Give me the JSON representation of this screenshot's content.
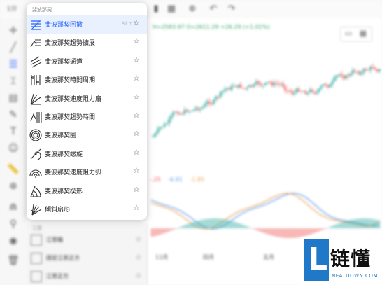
{
  "toolbar": {
    "left_label": "1分",
    "icons": [
      "candles-icon",
      "indicator-icon",
      "grid-icon",
      "add-icon",
      "undo-icon",
      "redo-icon"
    ]
  },
  "left_tools": [
    "crosshair-icon",
    "trendline-icon",
    "fibonacci-icon",
    "pattern-icon",
    "prediction-icon",
    "brush-icon",
    "text-icon",
    "emoji-icon",
    "ruler-icon",
    "zoom-icon",
    "magnet-icon",
    "lock-icon",
    "visibility-icon",
    "trash-icon"
  ],
  "chart": {
    "info_line": "H=2583.97  O=2611.29 +26.29 (+1.01%)",
    "indicator": {
      "v1": "-.25",
      "v2": "-6.91",
      "v3": "-1.85"
    },
    "x_labels": [
      "11月",
      "四月",
      "五月"
    ],
    "colors": {
      "up": "#26a69a",
      "down": "#ef5350",
      "line_a": "#5b9cf0",
      "line_b": "#f0a35b"
    }
  },
  "menu": {
    "section": "斐波那契",
    "items": [
      {
        "label": "斐波那契回撤",
        "shortcut": "Alt + F",
        "active": true,
        "icon": "fib-retracement-icon"
      },
      {
        "label": "斐波那契趨勢擴展",
        "shortcut": "",
        "active": false,
        "icon": "fib-extension-icon"
      },
      {
        "label": "斐波那契通道",
        "shortcut": "",
        "active": false,
        "icon": "fib-channel-icon"
      },
      {
        "label": "斐波那契時間周期",
        "shortcut": "",
        "active": false,
        "icon": "fib-time-zone-icon"
      },
      {
        "label": "斐波那契速度阻力扇",
        "shortcut": "",
        "active": false,
        "icon": "fib-fan-icon"
      },
      {
        "label": "斐波那契趨勢時間",
        "shortcut": "",
        "active": false,
        "icon": "fib-trend-time-icon"
      },
      {
        "label": "斐波那契圈",
        "shortcut": "",
        "active": false,
        "icon": "fib-circles-icon"
      },
      {
        "label": "斐波那契螺旋",
        "shortcut": "",
        "active": false,
        "icon": "fib-spiral-icon"
      },
      {
        "label": "斐波那契速度阻力弧",
        "shortcut": "",
        "active": false,
        "icon": "fib-arcs-icon"
      },
      {
        "label": "斐波那契楔形",
        "shortcut": "",
        "active": false,
        "icon": "fib-wedge-icon"
      },
      {
        "label": "傾斜扇形",
        "shortcut": "",
        "active": false,
        "icon": "pitchfan-icon"
      }
    ]
  },
  "lower_list": {
    "section": "江恩",
    "items": [
      "江恩箱",
      "固定江恩正方",
      "江恩正方"
    ]
  },
  "watermark": {
    "cn": "链懂",
    "en": "NEATDOWN.COM"
  }
}
